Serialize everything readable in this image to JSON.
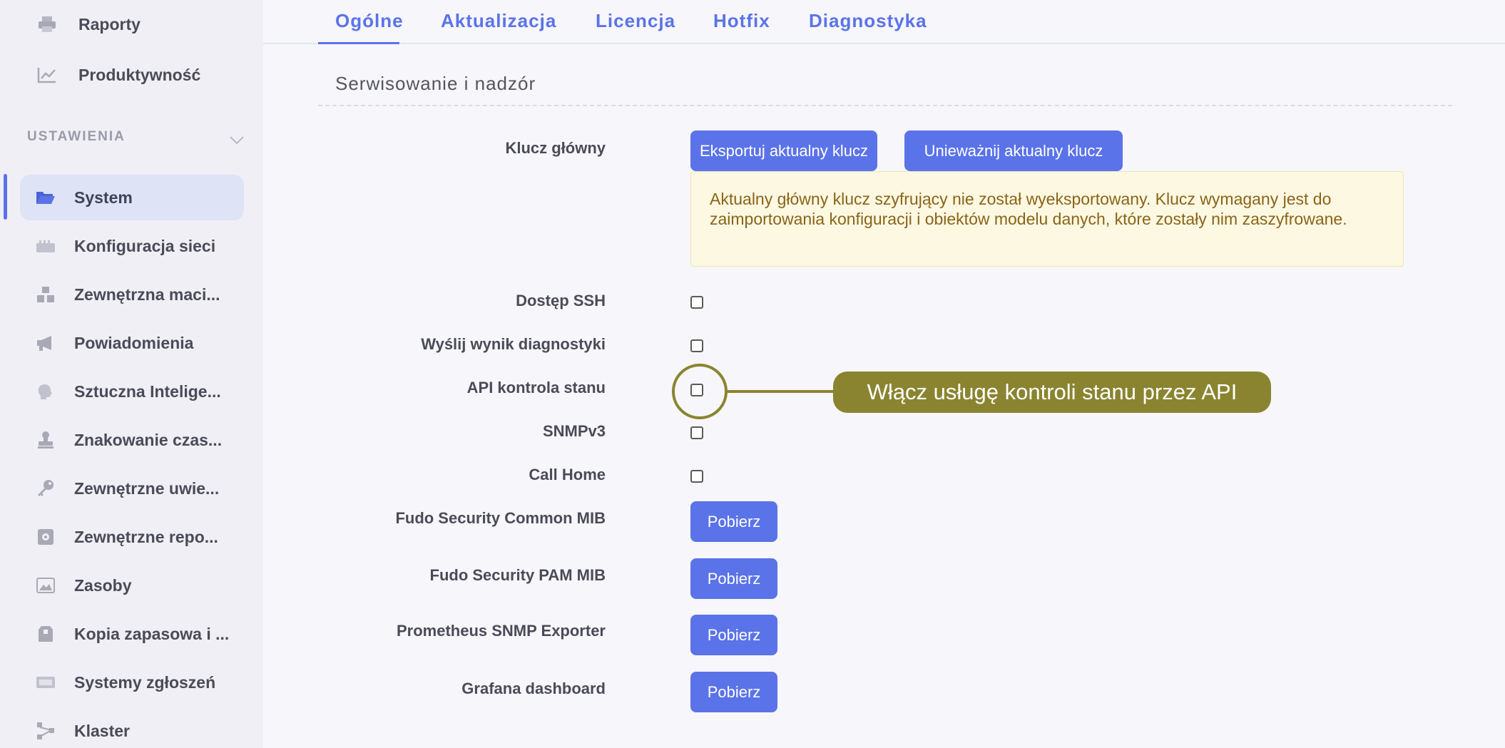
{
  "sidebar": {
    "top_items": [
      {
        "label": "Raporty",
        "icon": "printer-icon"
      },
      {
        "label": "Produktywność",
        "icon": "chart-line-icon"
      }
    ],
    "section_label": "USTAWIENIA",
    "items": [
      {
        "label": "System",
        "icon": "folder-open-icon",
        "active": true
      },
      {
        "label": "Konfiguracja sieci",
        "icon": "network-icon"
      },
      {
        "label": "Zewnętrzna maci...",
        "icon": "cubes-icon"
      },
      {
        "label": "Powiadomienia",
        "icon": "megaphone-icon"
      },
      {
        "label": "Sztuczna Intelige...",
        "icon": "brain-icon"
      },
      {
        "label": "Znakowanie czas...",
        "icon": "stamp-icon"
      },
      {
        "label": "Zewnętrzne uwie...",
        "icon": "key-icon"
      },
      {
        "label": "Zewnętrzne repo...",
        "icon": "vault-icon"
      },
      {
        "label": "Zasoby",
        "icon": "image-icon"
      },
      {
        "label": "Kopia zapasowa i ...",
        "icon": "archive-icon"
      },
      {
        "label": "Systemy zgłoszeń",
        "icon": "ticket-icon"
      },
      {
        "label": "Klaster",
        "icon": "cluster-icon"
      }
    ]
  },
  "tabs": [
    {
      "label": "Ogólne",
      "active": true
    },
    {
      "label": "Aktualizacja"
    },
    {
      "label": "Licencja"
    },
    {
      "label": "Hotfix"
    },
    {
      "label": "Diagnostyka"
    }
  ],
  "section": {
    "title": "Serwisowanie i nadzór"
  },
  "master_key": {
    "label": "Klucz główny",
    "export_button": "Eksportuj aktualny klucz",
    "revoke_button": "Unieważnij aktualny klucz",
    "notice": "Aktualny główny klucz szyfrujący nie został wyeksportowany. Klucz wymagany jest do zaimportowania konfiguracji i obiektów modelu danych, które zostały nim zaszyfrowane."
  },
  "options": [
    {
      "label": "Dostęp SSH",
      "checked": false
    },
    {
      "label": "Wyślij wynik diagnostyki",
      "checked": false
    },
    {
      "label": "API kontrola stanu",
      "checked": false
    },
    {
      "label": "SNMPv3",
      "checked": false
    },
    {
      "label": "Call Home",
      "checked": false
    }
  ],
  "downloads": [
    {
      "label": "Fudo Security Common MIB",
      "button": "Pobierz"
    },
    {
      "label": "Fudo Security PAM MIB",
      "button": "Pobierz"
    },
    {
      "label": "Prometheus SNMP Exporter",
      "button": "Pobierz"
    },
    {
      "label": "Grafana dashboard",
      "button": "Pobierz"
    }
  ],
  "callout": {
    "text": "Włącz usługę kontroli stanu przez API"
  },
  "colors": {
    "accent": "#5b73e8",
    "callout": "#8a8430",
    "notice_bg": "#fdf8e2",
    "notice_text": "#8a6418"
  }
}
